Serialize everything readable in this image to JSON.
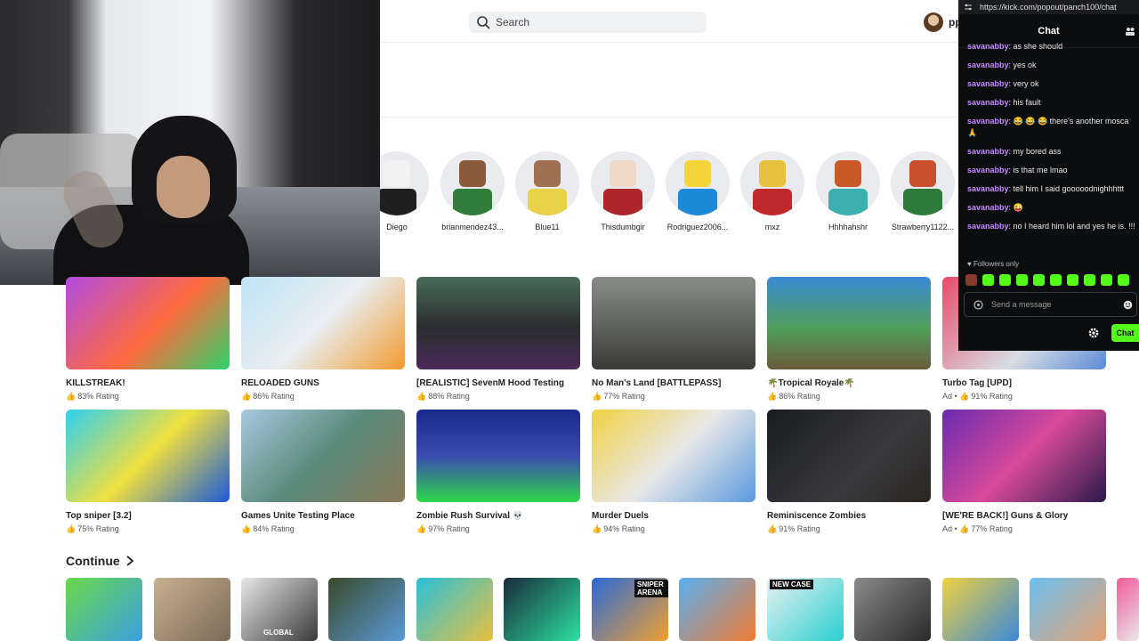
{
  "search": {
    "placeholder": "Search"
  },
  "user": {
    "name": "pp"
  },
  "friends": [
    {
      "name": "Diego"
    },
    {
      "name": "brianmendez43..."
    },
    {
      "name": "Blue11"
    },
    {
      "name": "Thisdumbgir"
    },
    {
      "name": "Rodriguez2006..."
    },
    {
      "name": "mxz"
    },
    {
      "name": "Hhhhahshr"
    },
    {
      "name": "Strawberry1122..."
    }
  ],
  "games_row1": [
    {
      "title": "KILLSTREAK!",
      "rating": "83% Rating",
      "ad": ""
    },
    {
      "title": "RELOADED GUNS",
      "rating": "86% Rating",
      "ad": ""
    },
    {
      "title": "[REALISTIC] SevenM Hood Testing",
      "rating": "88% Rating",
      "ad": ""
    },
    {
      "title": "No Man's Land [BATTLEPASS]",
      "rating": "77% Rating",
      "ad": ""
    },
    {
      "title": "🌴Tropical Royale🌴",
      "rating": "86% Rating",
      "ad": ""
    },
    {
      "title": "Turbo Tag [UPD]",
      "rating": "91% Rating",
      "ad": "Ad •"
    }
  ],
  "games_row2": [
    {
      "title": "Top sniper [3.2]",
      "rating": "75% Rating",
      "ad": ""
    },
    {
      "title": "Games Unite Testing Place",
      "rating": "84% Rating",
      "ad": ""
    },
    {
      "title": "Zombie Rush Survival 💀",
      "rating": "97% Rating",
      "ad": ""
    },
    {
      "title": "Murder Duels",
      "rating": "94% Rating",
      "ad": ""
    },
    {
      "title": "Reminiscence Zombies",
      "rating": "91% Rating",
      "ad": ""
    },
    {
      "title": "[WE'RE BACK!] Guns & Glory",
      "rating": "77% Rating",
      "ad": "Ad •"
    }
  ],
  "continue_section": {
    "title": "Continue"
  },
  "continue_badges": [
    "",
    "",
    "GLOBAL",
    "",
    "",
    "",
    "SNIPER ARENA",
    "",
    "NEW CASE",
    "",
    "",
    "",
    ""
  ],
  "chat": {
    "url": "https://kick.com/popout/panch100/chat",
    "title": "Chat",
    "messages": [
      {
        "user": "savanabby",
        "text": ": as she should"
      },
      {
        "user": "savanabby",
        "text": ": yes ok"
      },
      {
        "user": "savanabby",
        "text": ": very ok"
      },
      {
        "user": "savanabby",
        "text": ": his fault"
      },
      {
        "user": "savanabby",
        "text": ": 😂 😂 😂 there's another mosca 🙏"
      },
      {
        "user": "savanabby",
        "text": ": my bored ass"
      },
      {
        "user": "savanabby",
        "text": ": is that me lmao"
      },
      {
        "user": "savanabby",
        "text": ": tell him I said gooooodnighhhttt"
      },
      {
        "user": "savanabby",
        "text": ": 😜"
      },
      {
        "user": "savanabby",
        "text": ": no I heard him lol and yes he is. !!!"
      }
    ],
    "followers_label": "♥ Followers only",
    "input_placeholder": "Send a message",
    "send_label": "Chat"
  },
  "colors": {
    "kick_green": "#53fc18",
    "chat_username": "#c28aff",
    "chat_bg": "#0c0d0f"
  }
}
